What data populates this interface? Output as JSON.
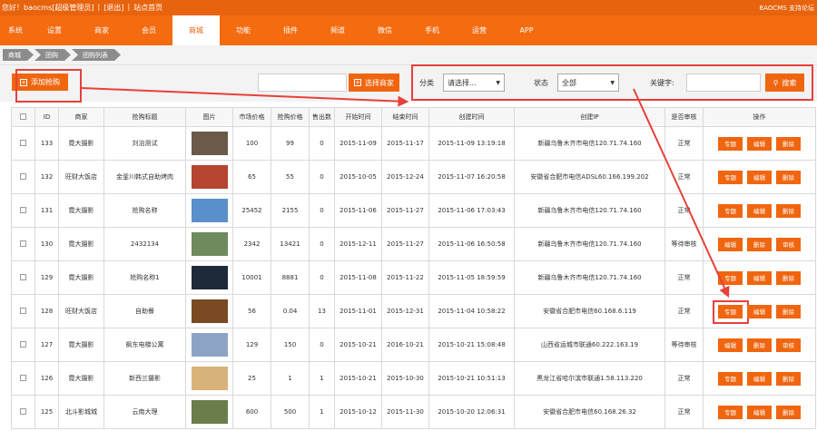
{
  "topbar": {
    "greeting": "您好！baocms[超级管理员]",
    "logout": "[退出]",
    "site_home": "站点首页",
    "sep": "|",
    "right": "BAOCMS 支持论坛"
  },
  "nav": [
    "系统",
    "设置",
    "商家",
    "会员",
    "商城",
    "功能",
    "插件",
    "频道",
    "微信",
    "手机",
    "运营",
    "APP"
  ],
  "nav_active_index": 4,
  "breadcrumb": [
    "商城",
    "团购",
    "团购列表"
  ],
  "toolbar": {
    "add_label": "添加抢购",
    "plus_icon": "plus-icon",
    "select_shop_label": "选择商家",
    "category_label": "分类",
    "category_value": "请选择...",
    "status_label": "状态",
    "status_value": "全部",
    "keyword_label": "关键字:",
    "search_label": "搜索",
    "search_icon": "search-icon",
    "caret": "▼",
    "plus_glyph": "+",
    "search_glyph": "⚲"
  },
  "table": {
    "headers": [
      "",
      "ID",
      "商家",
      "抢购标题",
      "图片",
      "市场价格",
      "抢购价格",
      "售出数",
      "开始时间",
      "结束时间",
      "创建时间",
      "创建IP",
      "是否审核",
      "操作"
    ],
    "action_labels": {
      "feature": "专题",
      "edit": "编辑",
      "delete": "删除",
      "review": "审核"
    },
    "rows": [
      {
        "id": "133",
        "shop": "霓大摄影",
        "title": "刘治测试",
        "market": "100",
        "price": "99",
        "sold": "0",
        "start": "2015-11-09",
        "end": "2015-11-17",
        "created": "2015-11-09 13:19:18",
        "ip": "新疆乌鲁木齐市电信120.71.74.160",
        "status": "正常",
        "thumb": "#6b5a4a"
      },
      {
        "id": "132",
        "shop": "旺财大饭店",
        "title": "金釜川韩式自助烤肉",
        "market": "65",
        "price": "55",
        "sold": "0",
        "start": "2015-10-05",
        "end": "2015-12-24",
        "created": "2015-11-07 16:20:58",
        "ip": "安徽省合肥市电信ADSL60.166.199.202",
        "status": "正常",
        "thumb": "#b5452e"
      },
      {
        "id": "131",
        "shop": "霓大摄影",
        "title": "抢购名称",
        "market": "25452",
        "price": "2155",
        "sold": "0",
        "start": "2015-11-06",
        "end": "2015-11-27",
        "created": "2015-11-06 17:03:43",
        "ip": "新疆乌鲁木齐市电信120.71.74.160",
        "status": "正常",
        "thumb": "#5b8fc9"
      },
      {
        "id": "130",
        "shop": "霓大摄影",
        "title": "2432134",
        "market": "2342",
        "price": "13421",
        "sold": "0",
        "start": "2015-12-11",
        "end": "2015-11-27",
        "created": "2015-11-06 16:50:58",
        "ip": "新疆乌鲁木齐市电信120.71.74.160",
        "status": "等待审核",
        "thumb": "#6f8a5c"
      },
      {
        "id": "129",
        "shop": "霓大摄影",
        "title": "抢购名称1",
        "market": "10001",
        "price": "8881",
        "sold": "0",
        "start": "2015-11-08",
        "end": "2015-11-22",
        "created": "2015-11-05 18:59:59",
        "ip": "新疆乌鲁木齐市电信120.71.74.160",
        "status": "正常",
        "thumb": "#1e2a3a"
      },
      {
        "id": "128",
        "shop": "旺财大饭店",
        "title": "自助餐",
        "market": "56",
        "price": "0.04",
        "sold": "13",
        "start": "2015-11-01",
        "end": "2015-12-31",
        "created": "2015-11-04 10:58:22",
        "ip": "安徽省合肥市电信60.168.6.119",
        "status": "正常",
        "thumb": "#7a4a22"
      },
      {
        "id": "127",
        "shop": "霓大摄影",
        "title": "枫东电梯公寓",
        "market": "129",
        "price": "150",
        "sold": "0",
        "start": "2015-10-21",
        "end": "2016-10-21",
        "created": "2015-10-21 15:08:48",
        "ip": "山西省运城市联通60.222.163.19",
        "status": "等待审核",
        "thumb": "#8da4c4"
      },
      {
        "id": "126",
        "shop": "霓大摄影",
        "title": "新西兰摄影",
        "market": "25",
        "price": "1",
        "sold": "1",
        "start": "2015-10-21",
        "end": "2015-10-30",
        "created": "2015-10-21 10:51:13",
        "ip": "黑龙江省哈尔滨市联通1.58.113.220",
        "status": "正常",
        "thumb": "#d9b27a"
      },
      {
        "id": "125",
        "shop": "北斗影城城",
        "title": "云南大理",
        "market": "600",
        "price": "500",
        "sold": "1",
        "start": "2015-10-12",
        "end": "2015-11-30",
        "created": "2015-10-20 12:06:31",
        "ip": "安徽省合肥市电信60.168.26.32",
        "status": "正常",
        "thumb": "#6a7d4a"
      }
    ]
  },
  "colors": {
    "brand": "#f46b10",
    "annotation": "#e8403a"
  }
}
